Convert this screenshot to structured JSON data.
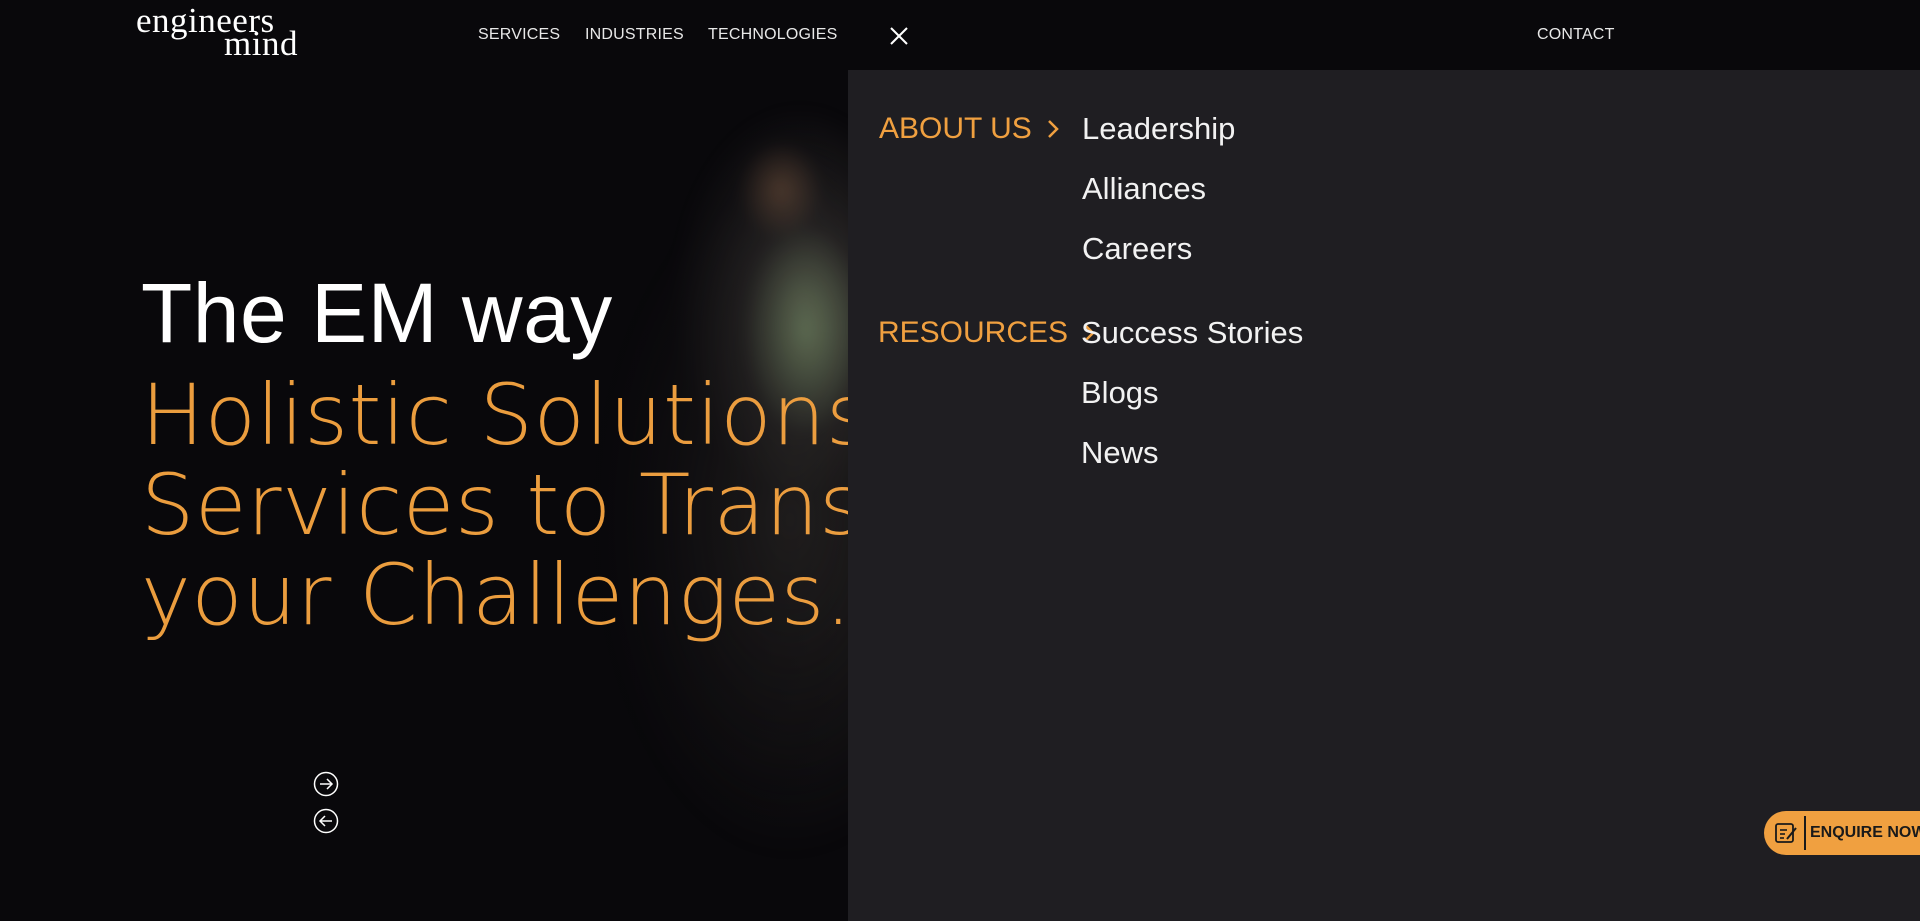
{
  "brand": {
    "logo_line1": "engineers",
    "logo_line2": "mind"
  },
  "nav": {
    "services": "SERVICES",
    "industries": "INDUSTRIES",
    "technologies": "TECHNOLOGIES",
    "contact": "CONTACT"
  },
  "hero": {
    "title": "The EM way",
    "subtitle_lines": [
      "Holistic Solutions and",
      "Services to Transform",
      "your Challenges."
    ]
  },
  "menu": {
    "about": {
      "label": "ABOUT US",
      "items": [
        "Leadership",
        "Alliances",
        "Careers"
      ]
    },
    "resources": {
      "label": "RESOURCES",
      "items": [
        "Success Stories",
        "Blogs",
        "News"
      ]
    }
  },
  "enquire": {
    "label": "ENQUIRE NOW"
  },
  "icons": {
    "close": "close-icon",
    "next": "arrow-right-circle-icon",
    "prev": "arrow-left-circle-icon",
    "chevron": "chevron-right-icon",
    "enquire": "form-edit-icon"
  },
  "colors": {
    "accent": "#f0a040",
    "header_bg": "#09080b",
    "menu_bg": "#1f1e22",
    "text": "#ffffff"
  }
}
